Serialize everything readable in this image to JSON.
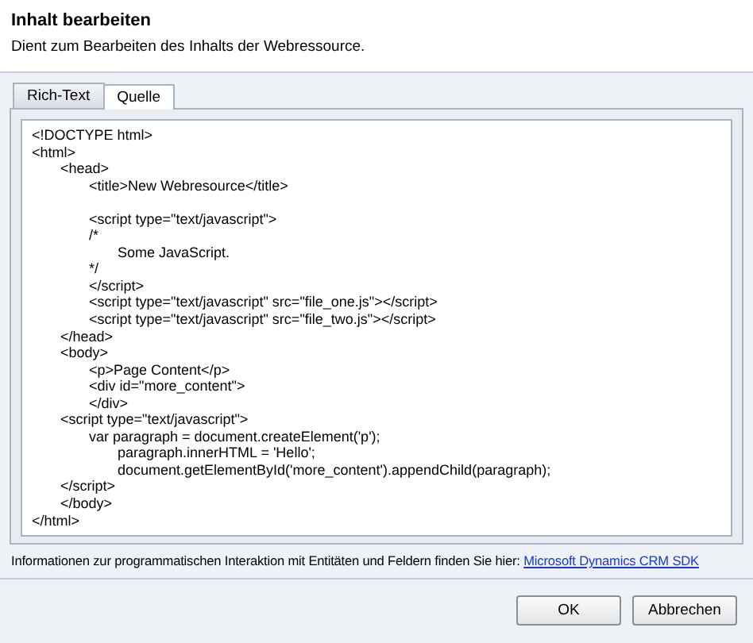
{
  "dialog": {
    "title": "Inhalt bearbeiten",
    "description": "Dient zum Bearbeiten des Inhalts der Webressource."
  },
  "tabs": [
    {
      "label": "Rich-Text",
      "selected": false
    },
    {
      "label": "Quelle",
      "selected": true
    }
  ],
  "source_code": [
    {
      "text": "<!DOCTYPE html>"
    },
    {
      "text": "<html>",
      "children": [
        {
          "text": "<head>",
          "children": [
            {
              "text": "<title>New Webresource</title>"
            },
            {
              "text": "<script type=\"text/javascript\">",
              "blank_line_before": true
            },
            {
              "text": "/*",
              "children": [
                {
                  "text": "Some JavaScript."
                }
              ]
            },
            {
              "text": "*/"
            },
            {
              "text": "</script>"
            },
            {
              "text": "<script type=\"text/javascript\" src=\"file_one.js\"></script>"
            },
            {
              "text": "<script type=\"text/javascript\" src=\"file_two.js\"></script>"
            }
          ]
        },
        {
          "text": "</head>"
        },
        {
          "text": "<body>",
          "children": [
            {
              "text": "<p>Page Content</p>"
            },
            {
              "text": "<div id=\"more_content\">"
            },
            {
              "text": "</div>"
            }
          ]
        },
        {
          "text": "<script type=\"text/javascript\">",
          "children": [
            {
              "text": "var paragraph = document.createElement('p');",
              "children": [
                {
                  "text": "paragraph.innerHTML = 'Hello';"
                },
                {
                  "text": "document.getElementById('more_content').appendChild(paragraph);"
                }
              ]
            }
          ]
        },
        {
          "text": "</script>"
        },
        {
          "text": "</body>"
        }
      ]
    },
    {
      "text": "</html>"
    }
  ],
  "footer_note": {
    "text": "Informationen zur programmatischen Interaktion mit Entitäten und Feldern finden Sie hier:",
    "link": "Microsoft Dynamics CRM SDK"
  },
  "buttons": [
    "OK",
    "Abbrechen"
  ]
}
